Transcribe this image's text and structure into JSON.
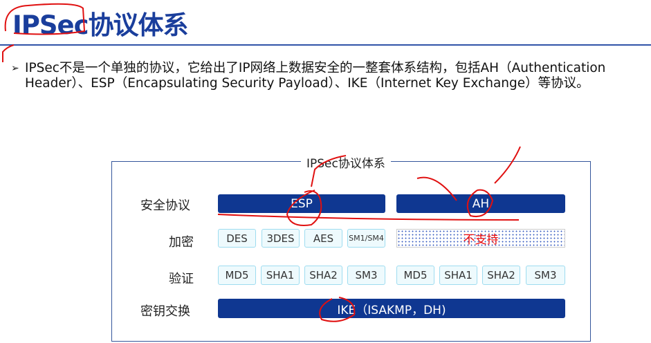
{
  "title": "IPSec协议体系",
  "bullet": "IPSec不是一个单独的协议，它给出了IP网络上数据安全的一整套体系结构，包括AH（Authentication Header）、ESP（Encapsulating Security Payload）、IKE（Internet Key Exchange）等协议。",
  "diagram": {
    "legend": "IPSec协议体系",
    "rows": {
      "security": "安全协议",
      "encryption": "加密",
      "auth": "验证",
      "keyx": "密钥交换"
    },
    "esp": "ESP",
    "ah": "AH",
    "esp_enc": [
      "DES",
      "3DES",
      "AES",
      "SM1/SM4"
    ],
    "ah_enc": "不支持",
    "esp_auth": [
      "MD5",
      "SHA1",
      "SHA2",
      "SM3"
    ],
    "ah_auth": [
      "MD5",
      "SHA1",
      "SHA2",
      "SM3"
    ],
    "ike": "IKE（ISAKMP，DH)"
  },
  "colors": {
    "brand": "#1a3e9c",
    "bar": "#0f3791",
    "annotation": "#e01010"
  }
}
